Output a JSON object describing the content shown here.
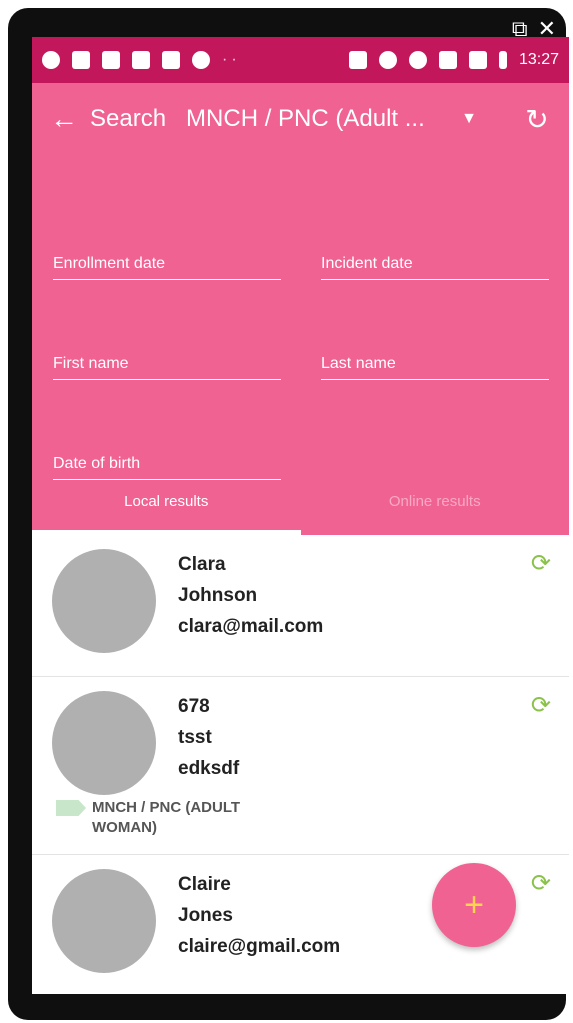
{
  "window_controls": {
    "popout_icon": "popout-icon",
    "close_icon": "close-icon"
  },
  "statusbar": {
    "time": "13:27",
    "dots": "··"
  },
  "appbar": {
    "title": "Search",
    "program": "MNCH / PNC (Adult ...",
    "dropdown_icon": "dropdown-icon",
    "reset_icon": "reset-icon",
    "back_icon": "back-icon"
  },
  "form": {
    "enrollment_date": "Enrollment date",
    "incident_date": "Incident date",
    "first_name": "First name",
    "last_name": "Last name",
    "date_of_birth": "Date of birth"
  },
  "tabs": {
    "local": "Local results",
    "online": "Online results"
  },
  "results": [
    {
      "line1": "Clara",
      "line2": "Johnson",
      "line3": "clara@mail.com"
    },
    {
      "line1": "678",
      "line2": "tsst",
      "line3": "edksdf",
      "tag": "MNCH / PNC (ADULT WOMAN)"
    },
    {
      "line1": "Claire",
      "line2": "Jones",
      "line3": "claire@gmail.com"
    }
  ],
  "fab": {
    "label": "+"
  },
  "colors": {
    "primary": "#f06292",
    "status_bar": "#c2185b",
    "sync_icon": "#8bc34a",
    "fab_icon": "#ffd54f"
  }
}
